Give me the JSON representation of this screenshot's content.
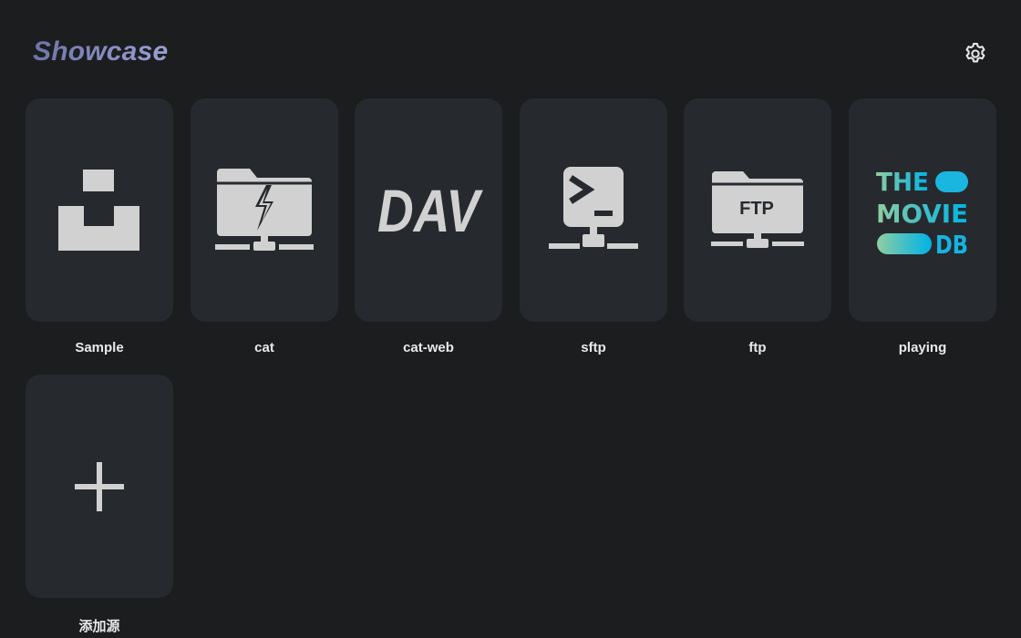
{
  "header": {
    "title": "Showcase",
    "settings_icon": "gear-icon"
  },
  "sources": [
    {
      "label": "Sample",
      "icon": "sample-icon"
    },
    {
      "label": "cat",
      "icon": "network-folder-lightning-icon"
    },
    {
      "label": "cat-web",
      "icon": "dav-logo-icon"
    },
    {
      "label": "sftp",
      "icon": "sftp-terminal-icon"
    },
    {
      "label": "ftp",
      "icon": "ftp-folder-icon"
    },
    {
      "label": "playing",
      "icon": "tmdb-logo-icon",
      "logo_text": [
        "THE",
        "MOVIE",
        "DB"
      ]
    },
    {
      "label": "添加源",
      "icon": "plus-icon"
    }
  ],
  "logos": {
    "dav": "DAV",
    "ftp": "FTP"
  },
  "colors": {
    "background": "#1b1d1f",
    "card": "#262a2e",
    "icon": "#d1d1d1",
    "tmdb_green": "#90cea1",
    "tmdb_blue": "#01b4e4"
  }
}
